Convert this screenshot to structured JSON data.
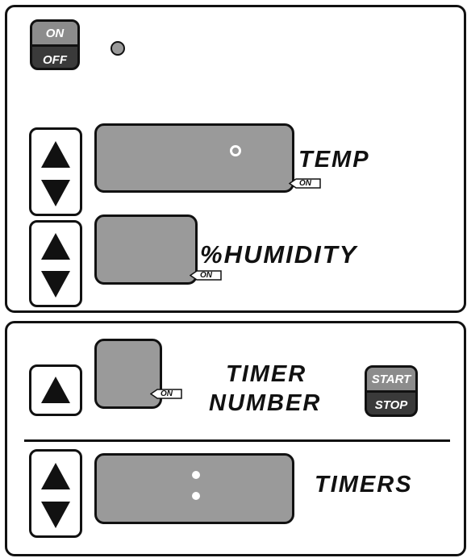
{
  "power": {
    "on_label": "ON",
    "off_label": "OFF"
  },
  "temp": {
    "label": "TEMP",
    "on_tag": "ON"
  },
  "humidity": {
    "label": "%HUMIDITY",
    "on_tag": "ON"
  },
  "timer_number": {
    "line1": "TIMER",
    "line2": "NUMBER",
    "on_tag": "ON"
  },
  "start_stop": {
    "start_label": "START",
    "stop_label": "STOP"
  },
  "timers": {
    "label": "TIMERS"
  },
  "colors": {
    "display": "#9a9a9a",
    "outline": "#111111",
    "button_dark": "#3a3a3a",
    "button_light": "#8c8c8c"
  }
}
